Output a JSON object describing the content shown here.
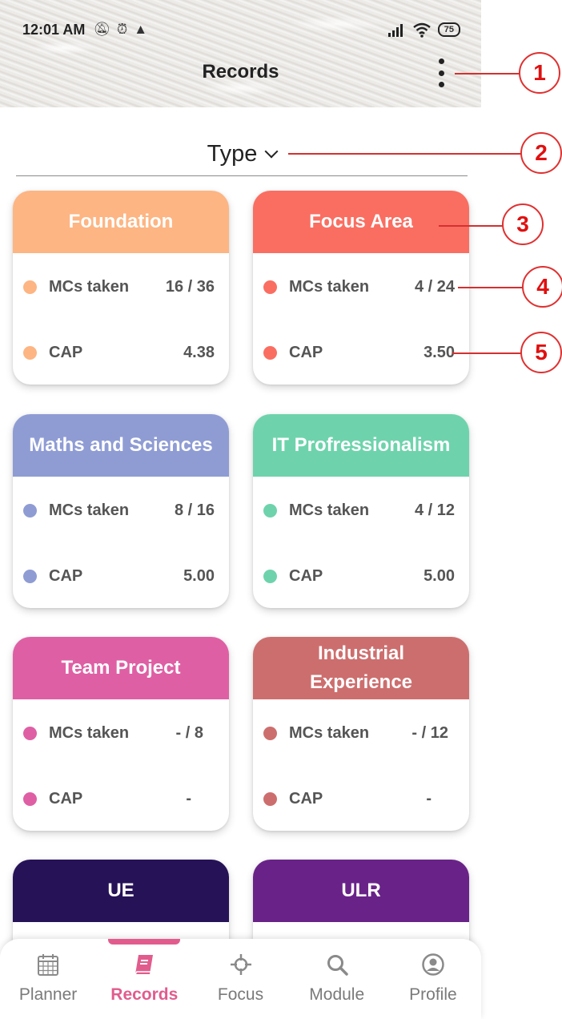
{
  "status_bar": {
    "time": "12:01 AM",
    "battery": "75"
  },
  "header": {
    "title": "Records"
  },
  "filter": {
    "type_label": "Type"
  },
  "cards": [
    {
      "title": "Foundation",
      "color": "#fdb583",
      "mcs_label": "MCs taken",
      "mcs": "16 / 36",
      "cap_label": "CAP",
      "cap": "4.38"
    },
    {
      "title": "Focus Area",
      "color": "#fa6e62",
      "mcs_label": "MCs taken",
      "mcs": "4 / 24",
      "cap_label": "CAP",
      "cap": "3.50"
    },
    {
      "title": "Maths and Sciences",
      "color": "#8f9cd4",
      "mcs_label": "MCs taken",
      "mcs": "8 / 16",
      "cap_label": "CAP",
      "cap": "5.00"
    },
    {
      "title": "IT Profressionalism",
      "color": "#6ed3ac",
      "mcs_label": "MCs taken",
      "mcs": "4 / 12",
      "cap_label": "CAP",
      "cap": "5.00"
    },
    {
      "title": "Team Project",
      "color": "#df5fa4",
      "mcs_label": "MCs taken",
      "mcs": "- / 8",
      "cap_label": "CAP",
      "cap": "-"
    },
    {
      "title": "Industrial Experience",
      "color": "#cd6e6e",
      "mcs_label": "MCs taken",
      "mcs": "- / 12",
      "cap_label": "CAP",
      "cap": "-"
    },
    {
      "title": "UE",
      "color": "#261257"
    },
    {
      "title": "ULR",
      "color": "#692388"
    }
  ],
  "annotations": [
    "1",
    "2",
    "3",
    "4",
    "5"
  ],
  "nav": {
    "active_color": "#e15c8d",
    "items": [
      {
        "label": "Planner",
        "icon": "calendar-icon"
      },
      {
        "label": "Records",
        "icon": "book-icon"
      },
      {
        "label": "Focus",
        "icon": "crosshair-icon"
      },
      {
        "label": "Module",
        "icon": "search-icon"
      },
      {
        "label": "Profile",
        "icon": "profile-icon"
      }
    ]
  }
}
